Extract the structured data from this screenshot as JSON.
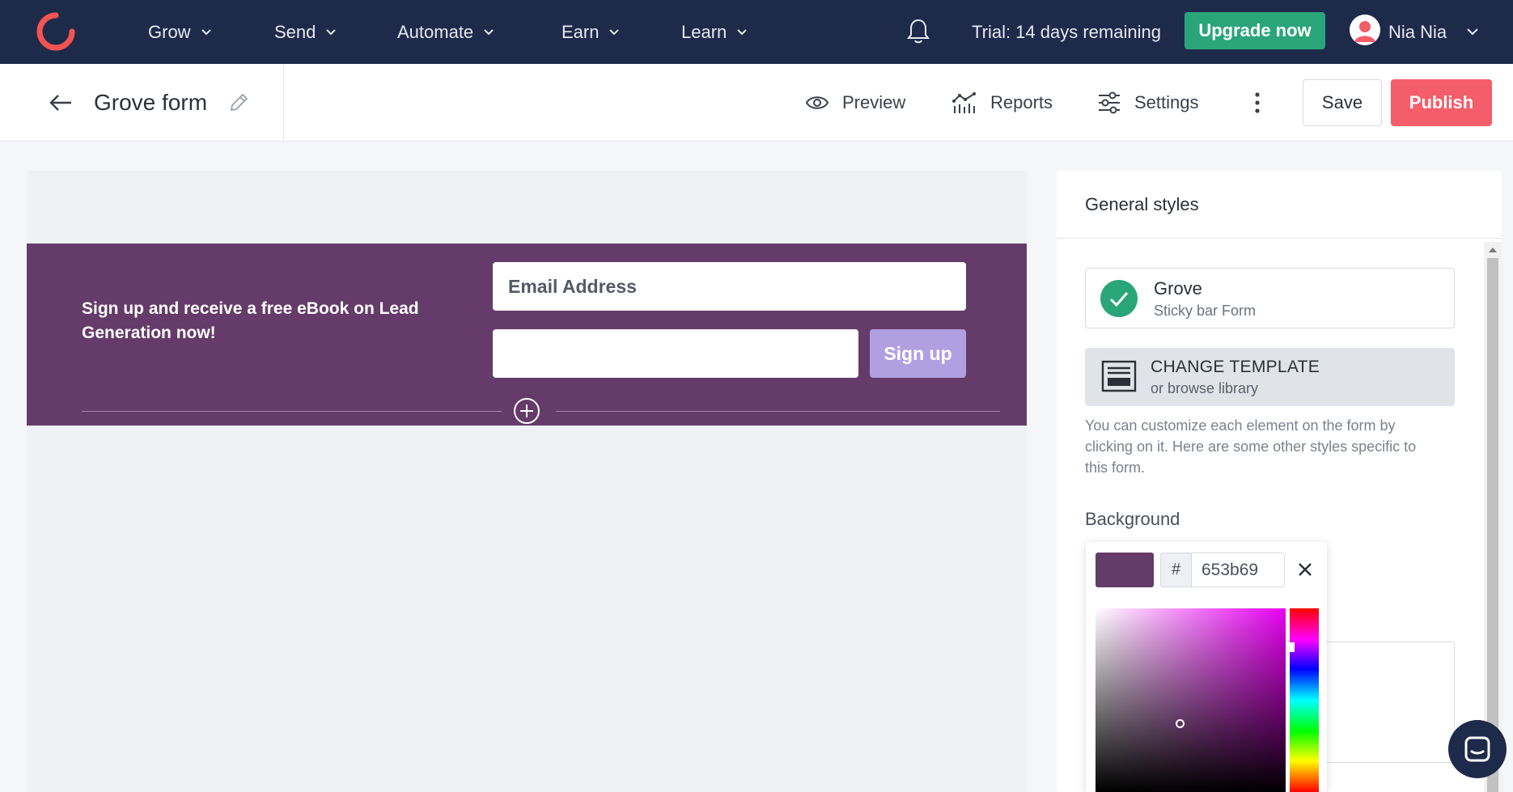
{
  "nav": {
    "items": [
      {
        "label": "Grow"
      },
      {
        "label": "Send"
      },
      {
        "label": "Automate"
      },
      {
        "label": "Earn"
      },
      {
        "label": "Learn"
      }
    ],
    "trial_text": "Trial: 14 days remaining",
    "upgrade_label": "Upgrade now",
    "user_name": "Nia Nia"
  },
  "toolbar": {
    "form_title": "Grove form",
    "preview_label": "Preview",
    "reports_label": "Reports",
    "settings_label": "Settings",
    "save_label": "Save",
    "publish_label": "Publish"
  },
  "form": {
    "headline": "Sign up and receive a free eBook on Lead Generation now!",
    "email_placeholder": "Email Address",
    "signup_label": "Sign up"
  },
  "panel": {
    "header": "General styles",
    "template_name": "Grove",
    "template_type": "Sticky bar Form",
    "change_title": "CHANGE TEMPLATE",
    "change_sub": "or browse library",
    "help_text": "You can customize each element on the form by clicking on it. Here are some other styles specific to this form.",
    "background_label": "Background"
  },
  "picker": {
    "hash_symbol": "#",
    "hex_value": "653b69"
  },
  "colors": {
    "nav_bg": "#1e2a4a",
    "brand_orange": "#f45d6a",
    "upgrade_green": "#2aa57a",
    "form_bg": "#653b69",
    "signup_btn": "#b0a0e2"
  }
}
